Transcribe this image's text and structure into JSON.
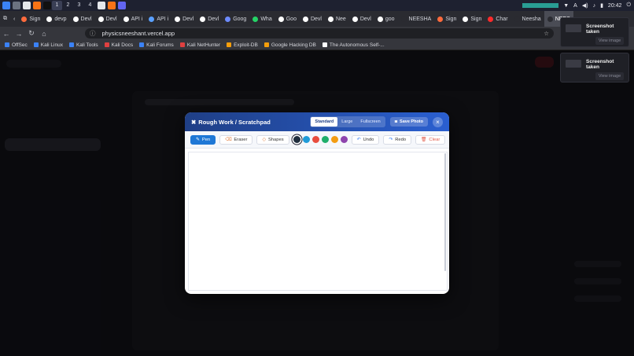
{
  "taskbar": {
    "workspaces": [
      "1",
      "2",
      "3",
      "4"
    ],
    "clock": "20:42"
  },
  "browser_tabs": [
    {
      "label": "Sign",
      "color": "#ff6b3d"
    },
    {
      "label": "devp",
      "color": "#ffffff"
    },
    {
      "label": "Devl",
      "color": "#ffffff"
    },
    {
      "label": "Devl",
      "color": "#ffffff"
    },
    {
      "label": "API i",
      "color": "#ffffff"
    },
    {
      "label": "API i",
      "color": "#5aa0ff"
    },
    {
      "label": "Devl",
      "color": "#ffffff"
    },
    {
      "label": "Devl",
      "color": "#ffffff"
    },
    {
      "label": "Goog",
      "color": "#6d8bff"
    },
    {
      "label": "Wha",
      "color": "#25d366"
    },
    {
      "label": "Goo",
      "color": "#ffffff"
    },
    {
      "label": "Devl",
      "color": "#ffffff"
    },
    {
      "label": "Nee",
      "color": "#ffffff"
    },
    {
      "label": "Devl",
      "color": "#ffffff"
    },
    {
      "label": "goo",
      "color": "#ffffff"
    },
    {
      "label": "NEESHA",
      "color": "#2a2b31"
    },
    {
      "label": "Sign",
      "color": "#ff6b3d"
    },
    {
      "label": "Sign",
      "color": "#ffffff"
    },
    {
      "label": "Char",
      "color": "#ff2b2b"
    },
    {
      "label": "Neesha",
      "color": "#2a2b31"
    },
    {
      "label": "NEES",
      "color": "#2a2b31",
      "active": true
    }
  ],
  "address_bar": {
    "url": "physicsneeshant.vercel.app"
  },
  "bookmarks": [
    {
      "label": "OffSec",
      "color": "#3b82f6"
    },
    {
      "label": "Kali Linux",
      "color": "#3b82f6"
    },
    {
      "label": "Kali Tools",
      "color": "#3b82f6"
    },
    {
      "label": "Kali Docs",
      "color": "#e04040"
    },
    {
      "label": "Kali Forums",
      "color": "#3b82f6"
    },
    {
      "label": "Kali NetHunter",
      "color": "#e04040"
    },
    {
      "label": "Exploit-DB",
      "color": "#f59e0b"
    },
    {
      "label": "Google Hacking DB",
      "color": "#f59e0b"
    },
    {
      "label": "The Autonomous Self-...",
      "color": "#ffffff"
    }
  ],
  "notifications": [
    {
      "title": "Screenshot taken",
      "action": "View image"
    },
    {
      "title": "Screenshot taken",
      "action": "View image"
    }
  ],
  "modal": {
    "title": "Rough Work / Scratchpad",
    "size_options": [
      {
        "label": "Standard",
        "selected": true
      },
      {
        "label": "Large",
        "selected": false
      },
      {
        "label": "Fullscreen",
        "selected": false
      }
    ],
    "save_label": "Save Photo",
    "close_label": "×",
    "tools": {
      "pen": "Pen",
      "eraser": "Eraser",
      "shapes": "Shapes",
      "undo": "Undo",
      "redo": "Redo",
      "clear": "Clear"
    },
    "colors": [
      "#1f2d3d",
      "#1f9bd8",
      "#e84c3d",
      "#1fae6b",
      "#f39c12",
      "#8e44ad"
    ],
    "selected_color": "#1f2d3d",
    "accent": "#1f78d6"
  }
}
